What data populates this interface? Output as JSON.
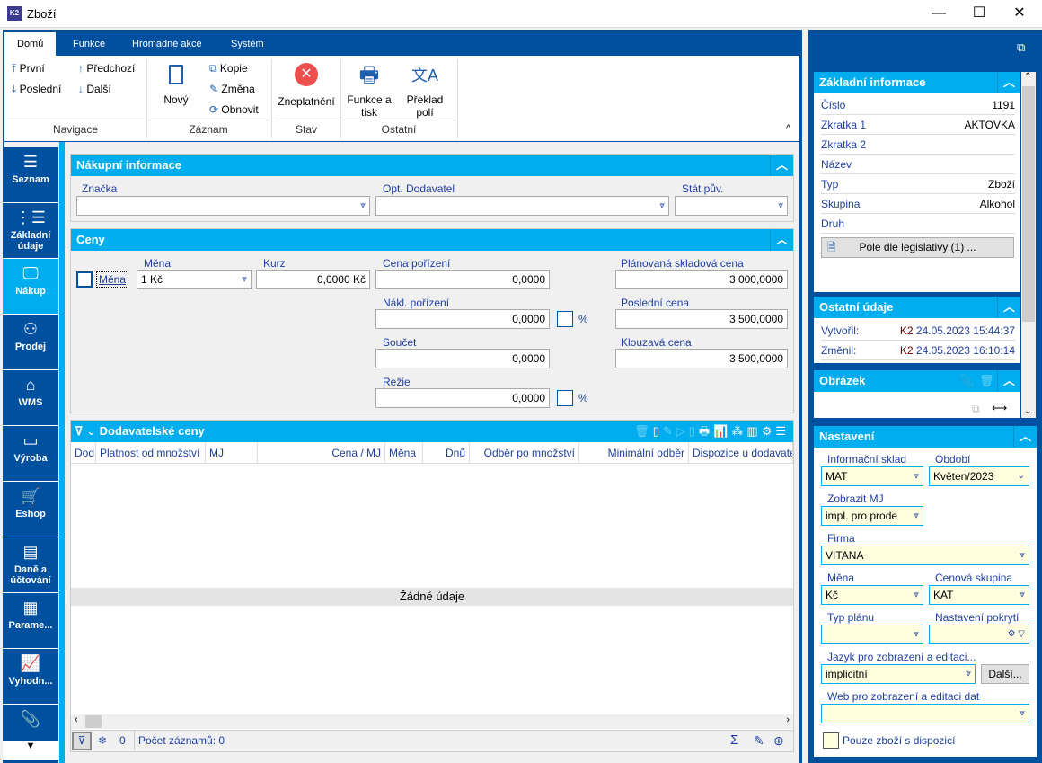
{
  "window": {
    "title": "Zboží",
    "logo": "K2",
    "minimize": "—",
    "maximize": "☐",
    "close": "✕"
  },
  "ribbon": {
    "tabs": [
      "Domů",
      "Funkce",
      "Hromadné akce",
      "Systém"
    ],
    "navigace": {
      "label": "Navigace",
      "first": "První",
      "last": "Poslední",
      "prev": "Předchozí",
      "next": "Další"
    },
    "zaznam": {
      "label": "Záznam",
      "new": "Nový",
      "copy": "Kopie",
      "change": "Změna",
      "refresh": "Obnovit"
    },
    "stav": {
      "label": "Stav",
      "invalidate": "Zneplatnění"
    },
    "ostatni": {
      "label": "Ostatní",
      "print": "Funkce a tisk",
      "translate": "Překlad polí"
    }
  },
  "nav": {
    "items": [
      {
        "label": "Seznam",
        "icon": "☰"
      },
      {
        "label": "Základní údaje",
        "icon": "⋮☰"
      },
      {
        "label": "Nákup",
        "icon": "🖵",
        "active": true
      },
      {
        "label": "Prodej",
        "icon": "⚇"
      },
      {
        "label": "WMS",
        "icon": "⌂"
      },
      {
        "label": "Výroba",
        "icon": "▭"
      },
      {
        "label": "Eshop",
        "icon": "🛒"
      },
      {
        "label": "Daně a účtování",
        "icon": "▤"
      },
      {
        "label": "Parame...",
        "icon": "▦"
      },
      {
        "label": "Vyhodn...",
        "icon": "📈"
      },
      {
        "label": "",
        "icon": "📎"
      }
    ],
    "more": "▼"
  },
  "purchase": {
    "title": "Nákupní informace",
    "brand_label": "Značka",
    "brand": "",
    "supplier_label": "Opt. Dodavatel",
    "supplier": "",
    "country_label": "Stát pův.",
    "country": ""
  },
  "prices": {
    "title": "Ceny",
    "currency_check_label": "Měna",
    "currency_label": "Měna",
    "currency": "1 Kč",
    "rate_label": "Kurz",
    "rate": "0,0000 Kč",
    "acq_label": "Cena pořízení",
    "acq": "0,0000",
    "acq_cost_label": "Nákl. pořízení",
    "acq_cost": "0,0000",
    "sum_label": "Součet",
    "sum": "0,0000",
    "overhead_label": "Režie",
    "overhead": "0,0000",
    "pct": "%",
    "planned_label": "Plánovaná skladová cena",
    "planned": "3 000,0000",
    "last_label": "Poslední cena",
    "last": "3 500,0000",
    "floating_label": "Klouzavá cena",
    "floating": "3 500,0000"
  },
  "supplier_prices": {
    "title": "Dodavatelské ceny",
    "columns": [
      "Dod",
      "Platnost od množství",
      "MJ",
      "Cena / MJ",
      "Měna",
      "Dnů",
      "Odběr po množství",
      "Minimální odběr",
      "Dispozice u dodavate"
    ],
    "empty": "Žádné údaje",
    "filter_count": "0",
    "record_count": "Počet záznamů: 0"
  },
  "right": {
    "basic": {
      "title": "Základní informace",
      "rows": [
        {
          "k": "Číslo",
          "v": "1191"
        },
        {
          "k": "Zkratka 1",
          "v": "AKTOVKA"
        },
        {
          "k": "Zkratka 2",
          "v": ""
        },
        {
          "k": "Název",
          "v": ""
        },
        {
          "k": "Typ",
          "v": "Zboží"
        },
        {
          "k": "Skupina",
          "v": "Alkohol"
        },
        {
          "k": "Druh",
          "v": ""
        }
      ],
      "legislation_button": "Pole dle legislativy (1) ..."
    },
    "other": {
      "title": "Ostatní údaje",
      "created_label": "Vytvořil:",
      "created_user": "K2",
      "created": "24.05.2023 15:44:37",
      "changed_label": "Změnil:",
      "changed_user": "K2",
      "changed": "24.05.2023 16:10:14"
    },
    "image": {
      "title": "Obrázek"
    },
    "settings": {
      "title": "Nastavení",
      "info_store_label": "Informační sklad",
      "info_store": "MAT",
      "period_label": "Období",
      "period": "Květen/2023",
      "unit_label": "Zobrazit MJ",
      "unit": "impl. pro prode",
      "company_label": "Firma",
      "company": "VITANA",
      "currency_label": "Měna",
      "currency": "Kč",
      "price_group_label": "Cenová skupina",
      "price_group": "KAT",
      "plan_type_label": "Typ plánu",
      "plan_type": "",
      "coverage_label": "Nastavení pokrytí",
      "coverage": "",
      "language_label": "Jazyk pro zobrazení a editaci...",
      "language": "implicitní",
      "more_button": "Další...",
      "web_label": "Web pro zobrazení a editaci dat",
      "web": "",
      "only_available_label": "Pouze zboží s dispozicí"
    }
  }
}
